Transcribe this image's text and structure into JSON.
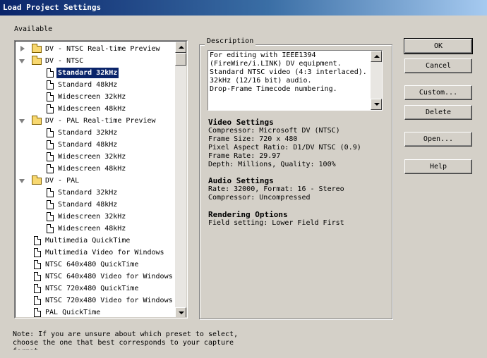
{
  "window": {
    "title": "Load Project Settings"
  },
  "available_label": "Available",
  "tree": {
    "items": [
      {
        "label": "DV - NTSC Real-time Preview",
        "type": "folder",
        "level": 0,
        "expanded": false
      },
      {
        "label": "DV - NTSC",
        "type": "folder",
        "level": 0,
        "expanded": true
      },
      {
        "label": "Standard 32kHz",
        "type": "preset",
        "level": 1,
        "selected": true
      },
      {
        "label": "Standard 48kHz",
        "type": "preset",
        "level": 1
      },
      {
        "label": "Widescreen 32kHz",
        "type": "preset",
        "level": 1
      },
      {
        "label": "Widescreen 48kHz",
        "type": "preset",
        "level": 1
      },
      {
        "label": "DV - PAL Real-time Preview",
        "type": "folder",
        "level": 0,
        "expanded": true
      },
      {
        "label": "Standard 32kHz",
        "type": "preset",
        "level": 1
      },
      {
        "label": "Standard 48kHz",
        "type": "preset",
        "level": 1
      },
      {
        "label": "Widescreen 32kHz",
        "type": "preset",
        "level": 1
      },
      {
        "label": "Widescreen 48kHz",
        "type": "preset",
        "level": 1
      },
      {
        "label": "DV - PAL",
        "type": "folder",
        "level": 0,
        "expanded": true
      },
      {
        "label": "Standard 32kHz",
        "type": "preset",
        "level": 1
      },
      {
        "label": "Standard 48kHz",
        "type": "preset",
        "level": 1
      },
      {
        "label": "Widescreen 32kHz",
        "type": "preset",
        "level": 1
      },
      {
        "label": "Widescreen 48kHz",
        "type": "preset",
        "level": 1
      },
      {
        "label": "Multimedia QuickTime",
        "type": "preset",
        "level": 0
      },
      {
        "label": "Multimedia Video for Windows",
        "type": "preset",
        "level": 0
      },
      {
        "label": "NTSC 640x480 QuickTime",
        "type": "preset",
        "level": 0
      },
      {
        "label": "NTSC 640x480 Video for Windows",
        "type": "preset",
        "level": 0
      },
      {
        "label": "NTSC 720x480 QuickTime",
        "type": "preset",
        "level": 0
      },
      {
        "label": "NTSC 720x480 Video for Windows",
        "type": "preset",
        "level": 0
      },
      {
        "label": "PAL QuickTime",
        "type": "preset",
        "level": 0
      }
    ]
  },
  "description": {
    "legend": "Description",
    "text": "For editing with IEEE1394\n(FireWire/i.LINK) DV equipment.\nStandard NTSC video (4:3 interlaced).\n32kHz (12/16 bit) audio.\nDrop-Frame Timecode numbering.",
    "video": {
      "heading": "Video Settings",
      "lines": [
        "Compressor: Microsoft DV (NTSC)",
        "Frame Size: 720 x 480",
        "Pixel Aspect Ratio: D1/DV NTSC (0.9)",
        "Frame Rate: 29.97",
        "Depth: Millions, Quality: 100%"
      ]
    },
    "audio": {
      "heading": "Audio Settings",
      "lines": [
        "Rate: 32000, Format: 16 - Stereo",
        "Compressor: Uncompressed"
      ]
    },
    "rendering": {
      "heading": "Rendering Options",
      "lines": [
        "Field setting: Lower Field First"
      ]
    }
  },
  "buttons": {
    "ok": "OK",
    "cancel": "Cancel",
    "custom": "Custom...",
    "delete": "Delete",
    "open": "Open...",
    "help": "Help"
  },
  "note": "Note: If you are unsure about which preset to select,\nchoose the one that best corresponds to your capture\nformat."
}
